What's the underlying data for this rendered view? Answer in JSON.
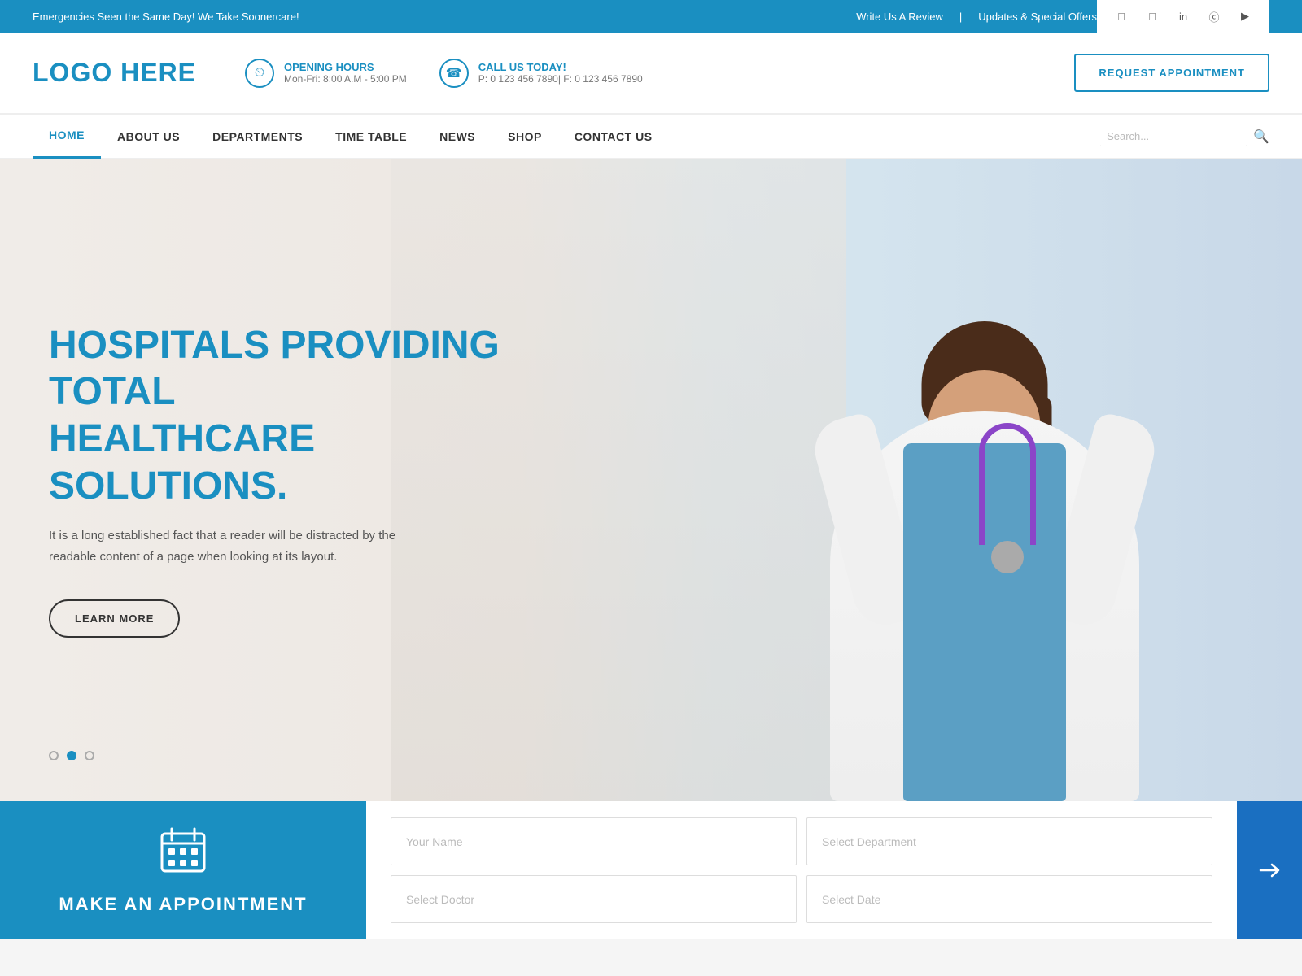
{
  "topbar": {
    "emergency_text": "Emergencies Seen the Same Day! We Take Soonercare!",
    "review_link": "Write Us A Review",
    "offers_link": "Updates & Special Offers",
    "divider": "|",
    "social": [
      "f",
      "t",
      "in",
      "ig",
      "yt"
    ]
  },
  "header": {
    "logo_bold": "LOGO",
    "logo_light": " HERE",
    "opening_label": "OPENING HOURS",
    "opening_value": "Mon-Fri: 8:00 A.M - 5:00 PM",
    "call_label": "CALL US TODAY!",
    "call_value": "P: 0 123 456 7890| F: 0 123 456 7890",
    "request_btn": "REQUEST APPOINTMENT"
  },
  "nav": {
    "links": [
      {
        "label": "HOME",
        "active": true
      },
      {
        "label": "ABOUT US",
        "active": false
      },
      {
        "label": "DEPARTMENTS",
        "active": false
      },
      {
        "label": "TIME TABLE",
        "active": false
      },
      {
        "label": "NEWS",
        "active": false
      },
      {
        "label": "SHOP",
        "active": false
      },
      {
        "label": "CONTACT US",
        "active": false
      }
    ],
    "search_placeholder": "Search..."
  },
  "hero": {
    "title_line1": "HOSPITALS PROVIDING TOTAL",
    "title_line2": "HEALTHCARE SOLUTIONS.",
    "subtitle": "It is a long established fact that a reader will be distracted by the readable content of a page when looking at its layout.",
    "learn_more_btn": "LEARN MORE",
    "dots": [
      false,
      true,
      false
    ]
  },
  "appointment": {
    "title": "MAKE AN APPOINTMENT",
    "form": {
      "name_placeholder": "Your Name",
      "department_placeholder": "Select Department",
      "doctor_placeholder": "Select Doctor",
      "date_placeholder": "Select Date"
    }
  }
}
